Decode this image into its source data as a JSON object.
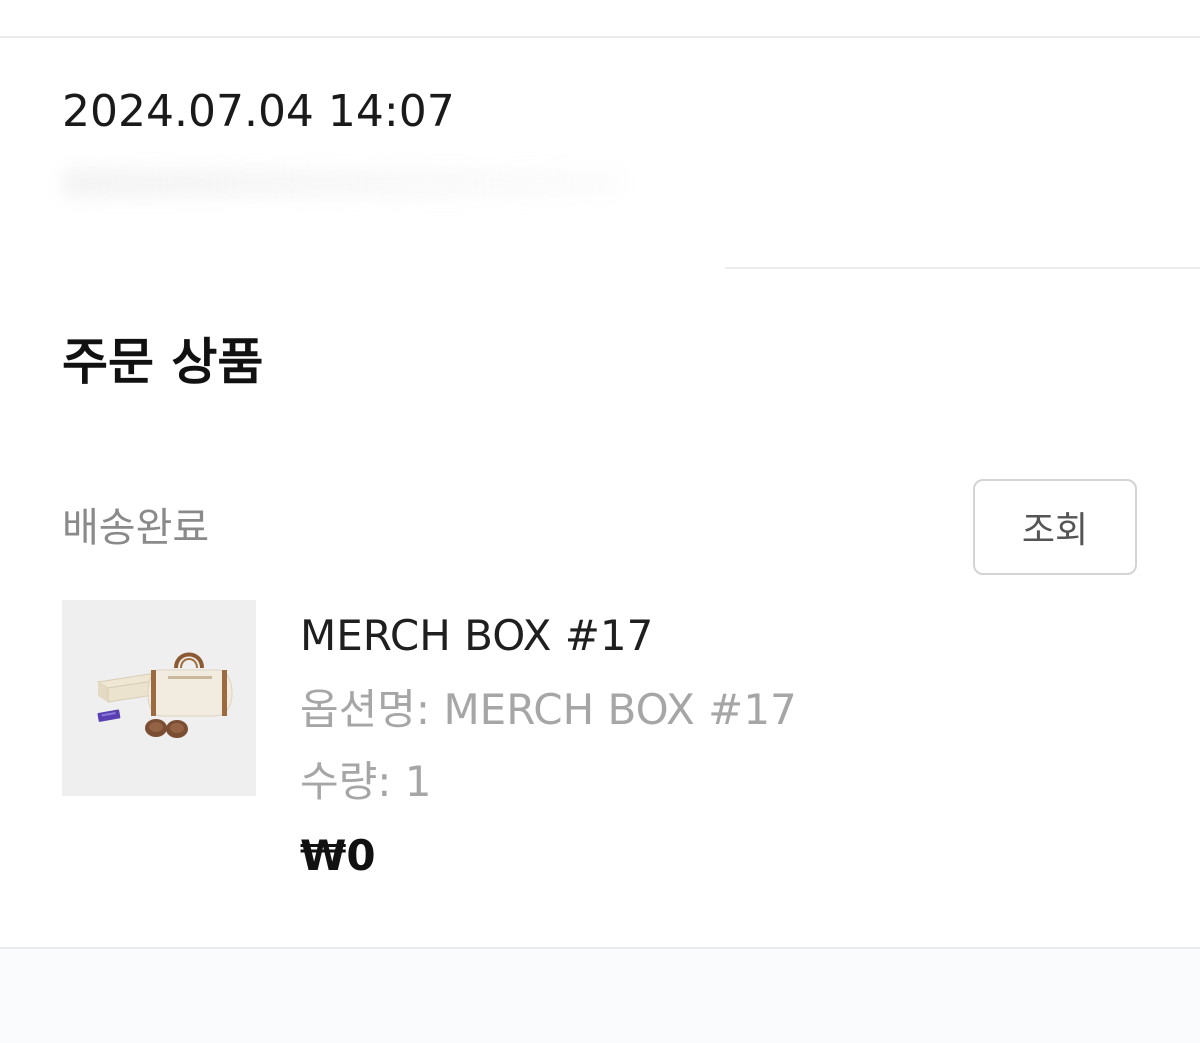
{
  "order": {
    "date": "2024.07.04 14:07"
  },
  "section": {
    "title": "주문 상품"
  },
  "item": {
    "status": "배송완료",
    "view_button_label": "조회",
    "thumbnail_alt": "MERCH BOX #17",
    "name": "MERCH BOX #17",
    "option_label": "옵션명",
    "option_value": "MERCH BOX #17",
    "quantity_label": "수량",
    "quantity": "1",
    "price": "₩0"
  },
  "colors": {
    "secondary_text": "#a6a6a6",
    "status_text": "#8a8a8a",
    "button_border": "#d4d4d4"
  }
}
